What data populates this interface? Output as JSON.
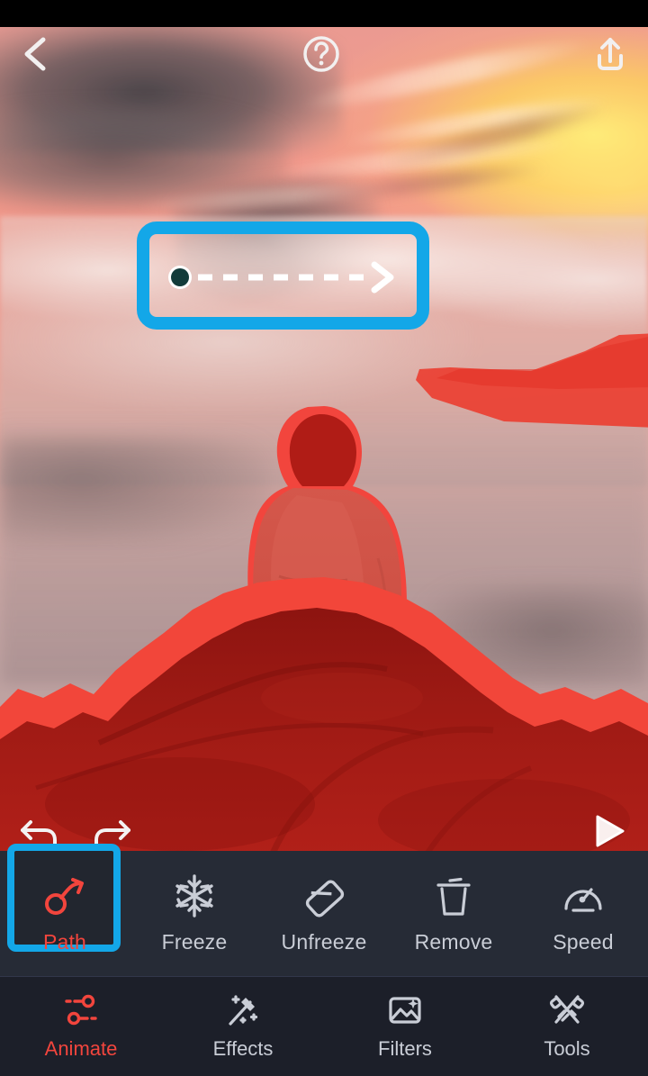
{
  "app": {
    "accent_red": "#f2453d",
    "highlight_blue": "#13a7e8",
    "toolbar_bg": "#262b36",
    "nav_bg": "#1c1f29",
    "mask_red": "#e8372b"
  },
  "topbar": {
    "back_icon": "chevron-left-icon",
    "help_icon": "question-mark-circle-icon",
    "share_icon": "share-upload-icon"
  },
  "canvas": {
    "description": "Person in hoodie sitting on a mountain rock above a sea of clouds at sunset, red freeze-mask overlay applied to subject, mountain and a brush stroke in sky",
    "path_overlay": {
      "start_dot": "path-start-point",
      "line_style": "dashed",
      "arrow_icon": "chevron-right-arrow-icon",
      "highlight_color": "#13a7e8"
    },
    "controls": {
      "undo_icon": "undo-arrow-icon",
      "redo_icon": "redo-arrow-icon",
      "play_icon": "play-triangle-icon"
    }
  },
  "toolbar": {
    "items": [
      {
        "label": "Path",
        "icon": "path-arrow-icon",
        "selected": true
      },
      {
        "label": "Freeze",
        "icon": "snowflake-icon",
        "selected": false
      },
      {
        "label": "Unfreeze",
        "icon": "eraser-icon",
        "selected": false
      },
      {
        "label": "Remove",
        "icon": "trash-can-icon",
        "selected": false
      },
      {
        "label": "Speed",
        "icon": "speedometer-icon",
        "selected": false
      }
    ]
  },
  "navbar": {
    "items": [
      {
        "label": "Animate",
        "icon": "animate-sliders-icon",
        "active": true
      },
      {
        "label": "Effects",
        "icon": "magic-wand-icon",
        "active": false
      },
      {
        "label": "Filters",
        "icon": "image-sparkle-icon",
        "active": false
      },
      {
        "label": "Tools",
        "icon": "pencil-ruler-icon",
        "active": false
      }
    ]
  }
}
